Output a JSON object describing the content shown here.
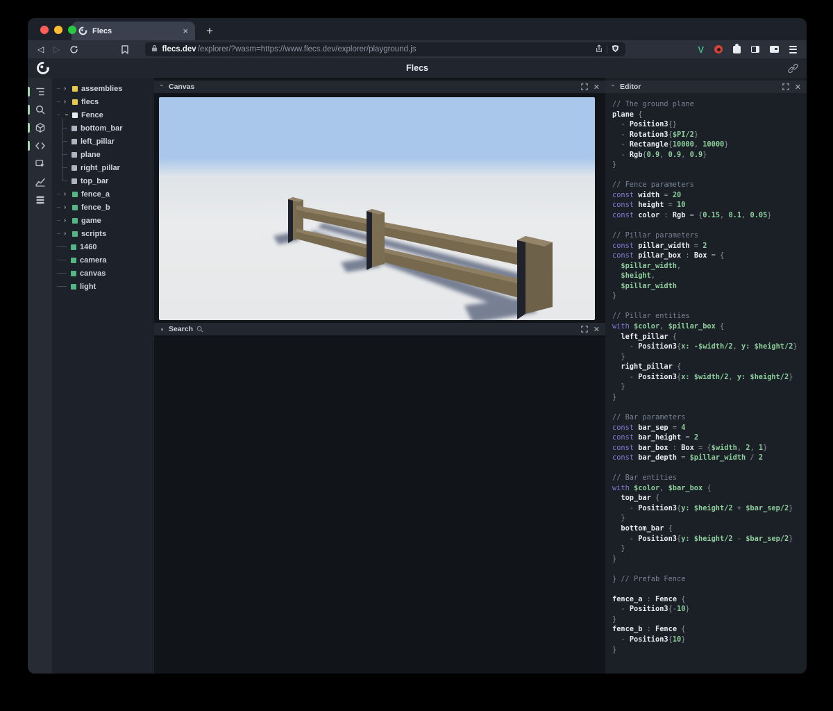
{
  "browser": {
    "tab_title": "Flecs",
    "new_tab_button": "+",
    "url_domain": "flecs.dev",
    "url_path": "/explorer/?wasm=https://www.flecs.dev/explorer/playground.js",
    "traffic_lights": {
      "close": "#ff5f57",
      "minimize": "#febc2e",
      "zoom": "#28c840"
    },
    "vue_devtools_color": "#42b883"
  },
  "app": {
    "title": "Flecs"
  },
  "sidebar": {
    "icons": [
      {
        "name": "outline-icon",
        "active": true
      },
      {
        "name": "search-icon",
        "active": true
      },
      {
        "name": "cube-icon",
        "active": true
      },
      {
        "name": "code-icon",
        "active": true
      },
      {
        "name": "inspect-icon",
        "active": false
      },
      {
        "name": "chart-icon",
        "active": false
      },
      {
        "name": "memory-icon",
        "active": false
      }
    ],
    "active_indicator_color": "#a5d8ab"
  },
  "tree": {
    "items": [
      {
        "label": "assemblies",
        "icon_color": "yellow",
        "state": "collapsed"
      },
      {
        "label": "flecs",
        "icon_color": "yellow",
        "state": "collapsed"
      },
      {
        "label": "Fence",
        "icon_color": "white",
        "state": "expanded"
      },
      {
        "label": "bottom_bar",
        "icon_color": "gray",
        "state": "child"
      },
      {
        "label": "left_pillar",
        "icon_color": "gray",
        "state": "child"
      },
      {
        "label": "plane",
        "icon_color": "gray",
        "state": "child"
      },
      {
        "label": "right_pillar",
        "icon_color": "gray",
        "state": "child"
      },
      {
        "label": "top_bar",
        "icon_color": "gray",
        "state": "child-last"
      },
      {
        "label": "fence_a",
        "icon_color": "green",
        "state": "collapsed"
      },
      {
        "label": "fence_b",
        "icon_color": "green",
        "state": "collapsed"
      },
      {
        "label": "game",
        "icon_color": "green",
        "state": "collapsed"
      },
      {
        "label": "scripts",
        "icon_color": "green",
        "state": "collapsed"
      },
      {
        "label": "1460",
        "icon_color": "green",
        "state": "leaf"
      },
      {
        "label": "camera",
        "icon_color": "green",
        "state": "leaf"
      },
      {
        "label": "canvas",
        "icon_color": "green",
        "state": "leaf"
      },
      {
        "label": "light",
        "icon_color": "green",
        "state": "leaf"
      }
    ]
  },
  "panels": {
    "canvas": {
      "title": "Canvas"
    },
    "search": {
      "title": "Search"
    },
    "editor": {
      "title": "Editor"
    }
  },
  "scene": {
    "sky": "#a9c7eb",
    "ground": "#e7e9ea",
    "wood_top": "#8d7d61",
    "wood_front": "#77694d",
    "pillar_front": "#7b6d51",
    "pillar_side": "#20232b",
    "pillar_top": "#94846a",
    "right_pillar_front": "#6e6149",
    "shadow": "#4d5873"
  },
  "editor": {
    "lines": [
      [
        [
          "c",
          "// The ground plane"
        ]
      ],
      [
        [
          "i",
          "plane"
        ],
        [
          "p",
          " {"
        ]
      ],
      [
        [
          "p",
          "  - "
        ],
        [
          "t",
          "Position3"
        ],
        [
          "p",
          "{}"
        ]
      ],
      [
        [
          "p",
          "  - "
        ],
        [
          "t",
          "Rotation3"
        ],
        [
          "p",
          "{"
        ],
        [
          "v",
          "$PI/2"
        ],
        [
          "p",
          "}"
        ]
      ],
      [
        [
          "p",
          "  - "
        ],
        [
          "t",
          "Rectangle"
        ],
        [
          "p",
          "{"
        ],
        [
          "n",
          "10000"
        ],
        [
          "p",
          ", "
        ],
        [
          "n",
          "10000"
        ],
        [
          "p",
          "}"
        ]
      ],
      [
        [
          "p",
          "  - "
        ],
        [
          "t",
          "Rgb"
        ],
        [
          "p",
          "{"
        ],
        [
          "n",
          "0.9"
        ],
        [
          "p",
          ", "
        ],
        [
          "n",
          "0.9"
        ],
        [
          "p",
          ", "
        ],
        [
          "n",
          "0.9"
        ],
        [
          "p",
          "}"
        ]
      ],
      [
        [
          "p",
          "}"
        ]
      ],
      [],
      [
        [
          "c",
          "// Fence parameters"
        ]
      ],
      [
        [
          "k",
          "const "
        ],
        [
          "i",
          "width"
        ],
        [
          "p",
          " = "
        ],
        [
          "n",
          "20"
        ]
      ],
      [
        [
          "k",
          "const "
        ],
        [
          "i",
          "height"
        ],
        [
          "p",
          " = "
        ],
        [
          "n",
          "10"
        ]
      ],
      [
        [
          "k",
          "const "
        ],
        [
          "i",
          "color"
        ],
        [
          "p",
          " : "
        ],
        [
          "t",
          "Rgb"
        ],
        [
          "p",
          " = {"
        ],
        [
          "n",
          "0.15"
        ],
        [
          "p",
          ", "
        ],
        [
          "n",
          "0.1"
        ],
        [
          "p",
          ", "
        ],
        [
          "n",
          "0.05"
        ],
        [
          "p",
          "}"
        ]
      ],
      [],
      [
        [
          "c",
          "// Pillar parameters"
        ]
      ],
      [
        [
          "k",
          "const "
        ],
        [
          "i",
          "pillar_width"
        ],
        [
          "p",
          " = "
        ],
        [
          "n",
          "2"
        ]
      ],
      [
        [
          "k",
          "const "
        ],
        [
          "i",
          "pillar_box"
        ],
        [
          "p",
          " : "
        ],
        [
          "t",
          "Box"
        ],
        [
          "p",
          " = {"
        ]
      ],
      [
        [
          "v",
          "  $pillar_width"
        ],
        [
          "p",
          ","
        ]
      ],
      [
        [
          "v",
          "  $height"
        ],
        [
          "p",
          ","
        ]
      ],
      [
        [
          "v",
          "  $pillar_width"
        ]
      ],
      [
        [
          "p",
          "}"
        ]
      ],
      [],
      [
        [
          "c",
          "// Pillar entities"
        ]
      ],
      [
        [
          "k",
          "with "
        ],
        [
          "v",
          "$color"
        ],
        [
          "p",
          ", "
        ],
        [
          "v",
          "$pillar_box"
        ],
        [
          "p",
          " {"
        ]
      ],
      [
        [
          "i",
          "  left_pillar"
        ],
        [
          "p",
          " {"
        ]
      ],
      [
        [
          "p",
          "    - "
        ],
        [
          "t",
          "Position3"
        ],
        [
          "p",
          "{"
        ],
        [
          "v",
          "x: -$width/2"
        ],
        [
          "p",
          ", "
        ],
        [
          "v",
          "y: $height/2"
        ],
        [
          "p",
          "}"
        ]
      ],
      [
        [
          "p",
          "  }"
        ]
      ],
      [
        [
          "i",
          "  right_pillar"
        ],
        [
          "p",
          " {"
        ]
      ],
      [
        [
          "p",
          "    - "
        ],
        [
          "t",
          "Position3"
        ],
        [
          "p",
          "{"
        ],
        [
          "v",
          "x: $width/2"
        ],
        [
          "p",
          ", "
        ],
        [
          "v",
          "y: $height/2"
        ],
        [
          "p",
          "}"
        ]
      ],
      [
        [
          "p",
          "  }"
        ]
      ],
      [
        [
          "p",
          "}"
        ]
      ],
      [],
      [
        [
          "c",
          "// Bar parameters"
        ]
      ],
      [
        [
          "k",
          "const "
        ],
        [
          "i",
          "bar_sep"
        ],
        [
          "p",
          " = "
        ],
        [
          "n",
          "4"
        ]
      ],
      [
        [
          "k",
          "const "
        ],
        [
          "i",
          "bar_height"
        ],
        [
          "p",
          " = "
        ],
        [
          "n",
          "2"
        ]
      ],
      [
        [
          "k",
          "const "
        ],
        [
          "i",
          "bar_box"
        ],
        [
          "p",
          " : "
        ],
        [
          "t",
          "Box"
        ],
        [
          "p",
          " = {"
        ],
        [
          "v",
          "$width"
        ],
        [
          "p",
          ", "
        ],
        [
          "n",
          "2"
        ],
        [
          "p",
          ", "
        ],
        [
          "n",
          "1"
        ],
        [
          "p",
          "}"
        ]
      ],
      [
        [
          "k",
          "const "
        ],
        [
          "i",
          "bar_depth"
        ],
        [
          "p",
          " = "
        ],
        [
          "v",
          "$pillar_width"
        ],
        [
          "p",
          " / "
        ],
        [
          "n",
          "2"
        ]
      ],
      [],
      [
        [
          "c",
          "// Bar entities"
        ]
      ],
      [
        [
          "k",
          "with "
        ],
        [
          "v",
          "$color"
        ],
        [
          "p",
          ", "
        ],
        [
          "v",
          "$bar_box"
        ],
        [
          "p",
          " {"
        ]
      ],
      [
        [
          "i",
          "  top_bar"
        ],
        [
          "p",
          " {"
        ]
      ],
      [
        [
          "p",
          "    - "
        ],
        [
          "t",
          "Position3"
        ],
        [
          "p",
          "{"
        ],
        [
          "v",
          "y: $height/2"
        ],
        [
          "p",
          " + "
        ],
        [
          "v",
          "$bar_sep/2"
        ],
        [
          "p",
          "}"
        ]
      ],
      [
        [
          "p",
          "  }"
        ]
      ],
      [
        [
          "i",
          "  bottom_bar"
        ],
        [
          "p",
          " {"
        ]
      ],
      [
        [
          "p",
          "    - "
        ],
        [
          "t",
          "Position3"
        ],
        [
          "p",
          "{"
        ],
        [
          "v",
          "y: $height/2"
        ],
        [
          "p",
          " - "
        ],
        [
          "v",
          "$bar_sep/2"
        ],
        [
          "p",
          "}"
        ]
      ],
      [
        [
          "p",
          "  }"
        ]
      ],
      [
        [
          "p",
          "}"
        ]
      ],
      [],
      [
        [
          "p",
          "} "
        ],
        [
          "c",
          "// Prefab Fence"
        ]
      ],
      [],
      [
        [
          "i",
          "fence_a"
        ],
        [
          "p",
          " : "
        ],
        [
          "t",
          "Fence"
        ],
        [
          "p",
          " {"
        ]
      ],
      [
        [
          "p",
          "  - "
        ],
        [
          "t",
          "Position3"
        ],
        [
          "p",
          "{-"
        ],
        [
          "n",
          "10"
        ],
        [
          "p",
          "}"
        ]
      ],
      [
        [
          "p",
          "}"
        ]
      ],
      [
        [
          "i",
          "fence_b"
        ],
        [
          "p",
          " : "
        ],
        [
          "t",
          "Fence"
        ],
        [
          "p",
          " {"
        ]
      ],
      [
        [
          "p",
          "  - "
        ],
        [
          "t",
          "Position3"
        ],
        [
          "p",
          "{"
        ],
        [
          "n",
          "10"
        ],
        [
          "p",
          "}"
        ]
      ],
      [
        [
          "p",
          "}"
        ]
      ]
    ]
  }
}
